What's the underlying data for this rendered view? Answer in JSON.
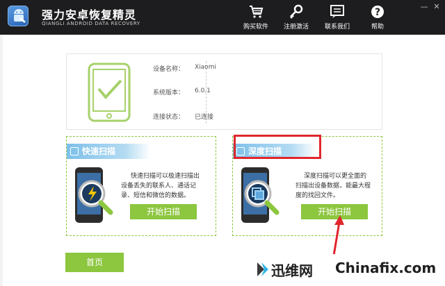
{
  "app": {
    "title": "强力安卓恢复精灵",
    "subtitle": "QIANGLI ANDROID DATA RECOVERY"
  },
  "nav": [
    {
      "label": "购买软件",
      "icon": "cart-icon"
    },
    {
      "label": "注册激活",
      "icon": "key-icon"
    },
    {
      "label": "联系我们",
      "icon": "chat-icon"
    },
    {
      "label": "帮助",
      "icon": "help-icon"
    }
  ],
  "window_controls": {
    "minimize": "—",
    "close": "✕"
  },
  "device": {
    "name_label": "设备名称：",
    "name_value": "Xiaomi",
    "version_label": "系统版本：",
    "version_value": "6.0.1",
    "status_label": "连接状态：",
    "status_value": "已连接"
  },
  "quick_scan": {
    "title": "快速扫描",
    "description_lines": [
      "快速扫描可以极速扫描出",
      "设备丢失的联系人、通话记",
      "录、短信和微信的数据。"
    ],
    "button": "开始扫描"
  },
  "deep_scan": {
    "title": "深度扫描",
    "description_lines": [
      "深度扫描可以更全面的",
      "扫描出设备数据，能最大程",
      "度的找回文件。"
    ],
    "button": "开始扫描"
  },
  "home_button": "首页",
  "watermark": {
    "cn": "迅维网",
    "en": "Chinafix.com"
  },
  "colors": {
    "titlebar": "#1d1d1f",
    "accent_green": "#8dc63f",
    "panel_header_blue": "#7dc0ea",
    "highlight_red": "#e0262c"
  }
}
